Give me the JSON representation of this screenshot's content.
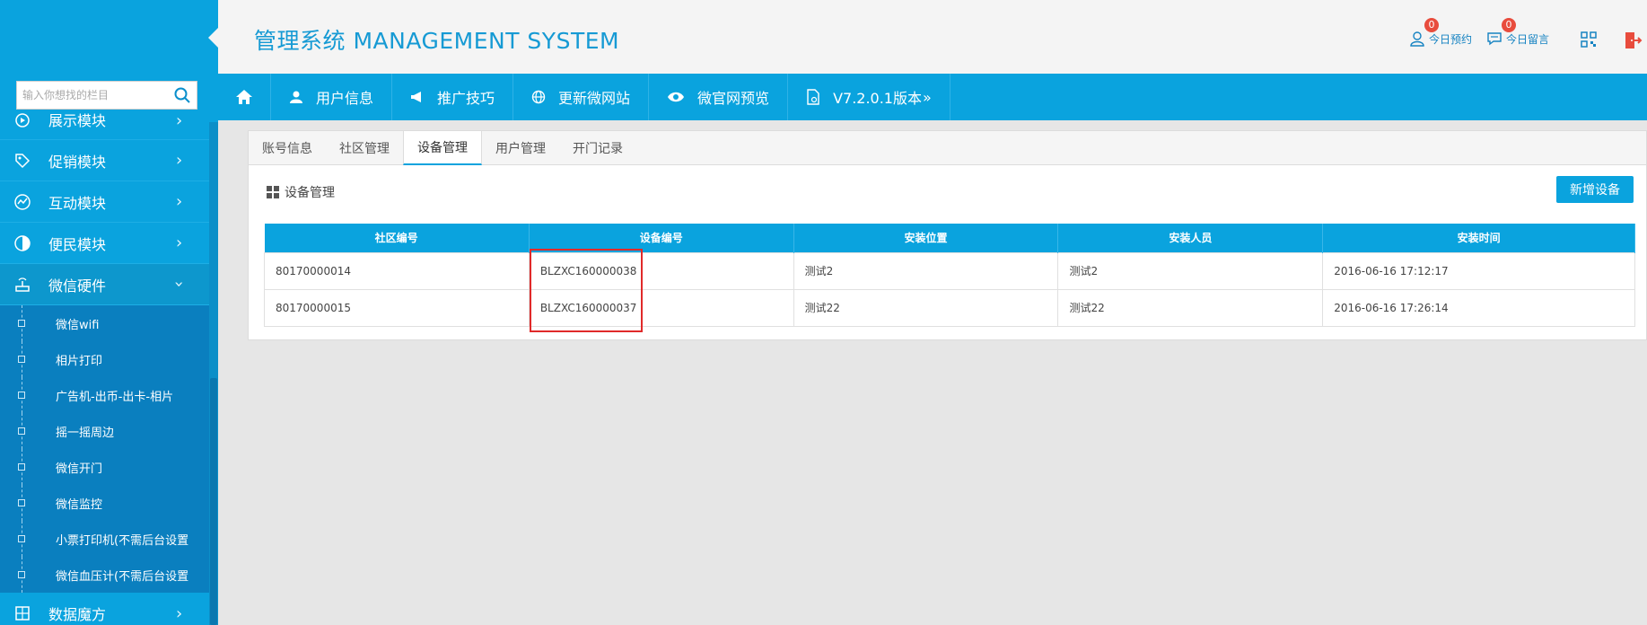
{
  "header": {
    "title": "管理系统 MANAGEMENT SYSTEM",
    "reservations_label": "今日预约",
    "reservations_count": "0",
    "messages_label": "今日留言",
    "messages_count": "0"
  },
  "sidebar": {
    "search_placeholder": "输入你想找的栏目",
    "items": [
      {
        "label": "展示模块",
        "icon": "display-icon"
      },
      {
        "label": "促销模块",
        "icon": "tag-icon"
      },
      {
        "label": "互动模块",
        "icon": "interaction-icon"
      },
      {
        "label": "便民模块",
        "icon": "service-icon"
      },
      {
        "label": "微信硬件",
        "icon": "router-icon"
      }
    ],
    "submenu": [
      "微信wifi",
      "相片打印",
      "广告机-出币-出卡-相片",
      "摇一摇周边",
      "微信开门",
      "微信监控",
      "小票打印机(不需后台设置",
      "微信血压计(不需后台设置"
    ],
    "bottom_item": "数据魔方"
  },
  "topnav": {
    "items": [
      "用户信息",
      "推广技巧",
      "更新微网站",
      "微官网预览",
      "V7.2.0.1版本"
    ]
  },
  "tabs": [
    "账号信息",
    "社区管理",
    "设备管理",
    "用户管理",
    "开门记录"
  ],
  "active_tab": "设备管理",
  "section": {
    "title": "设备管理",
    "add_button": "新增设备"
  },
  "table": {
    "columns": [
      "社区编号",
      "设备编号",
      "安装位置",
      "安装人员",
      "安装时间"
    ],
    "rows": [
      [
        "80170000014",
        "BLZXC160000038",
        "测试2",
        "测试2",
        "2016-06-16 17:12:17"
      ],
      [
        "80170000015",
        "BLZXC160000037",
        "测试22",
        "测试22",
        "2016-06-16 17:26:14"
      ]
    ]
  },
  "colors": {
    "primary": "#0aa3de",
    "submenu_bg": "#0a7fbf",
    "badge": "#e84c3d",
    "highlight": "#e02a2a"
  }
}
